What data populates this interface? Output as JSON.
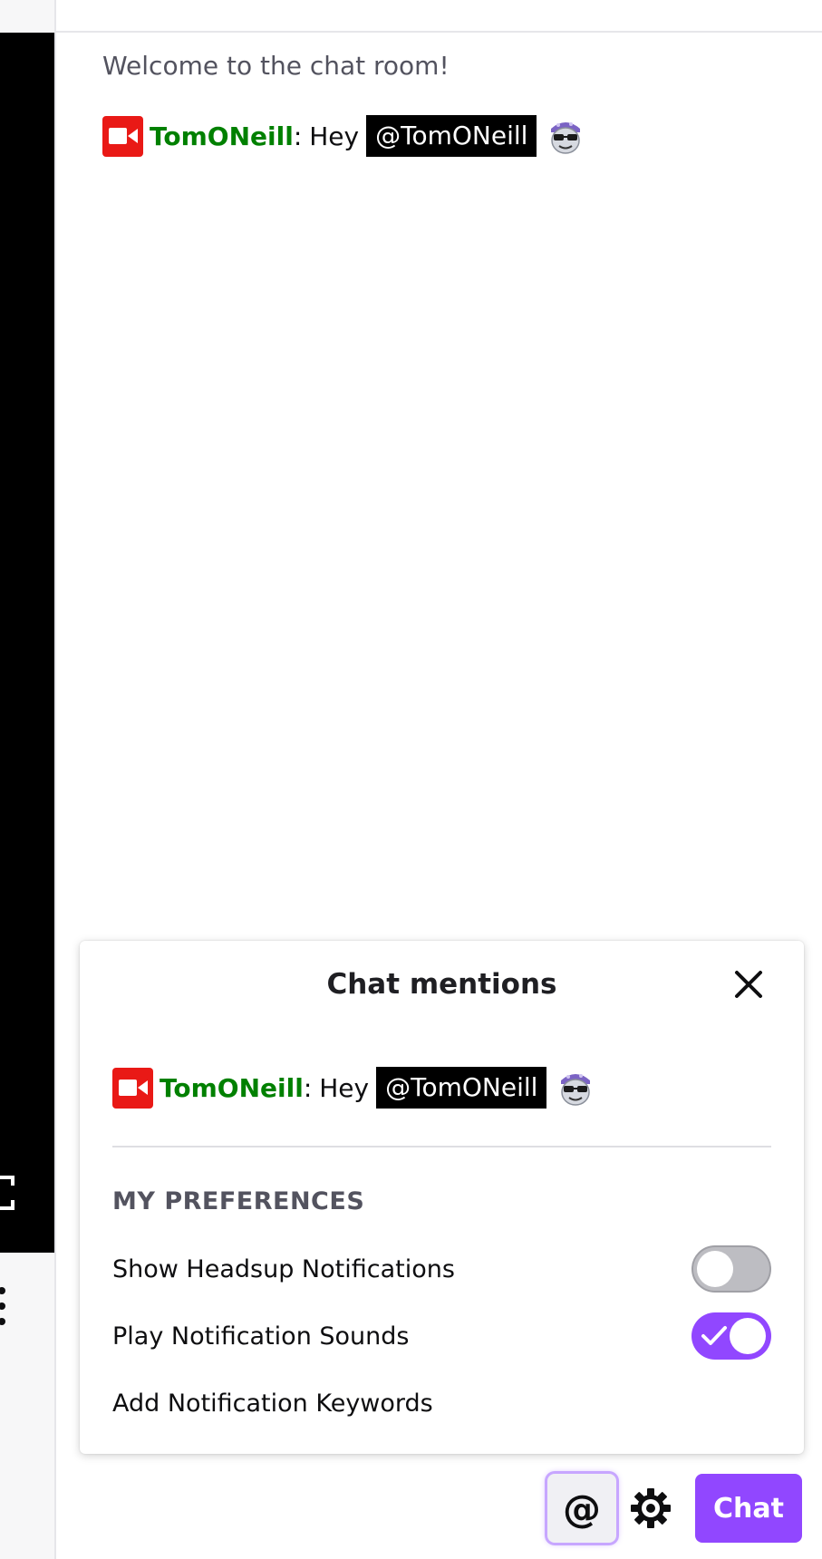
{
  "chat": {
    "welcome": "Welcome to the chat room!",
    "messages": [
      {
        "username": "TomONeill",
        "colon": ":",
        "text": "Hey",
        "mention": "@TomONeill",
        "badge_icon": "video-camera-icon",
        "emote_icon": "cool-face-emote-icon"
      }
    ]
  },
  "mentions_popup": {
    "title": "Chat mentions",
    "close_icon": "close-icon",
    "message": {
      "username": "TomONeill",
      "colon": ":",
      "text": "Hey",
      "mention": "@TomONeill"
    },
    "preferences_heading": "MY PREFERENCES",
    "preferences": [
      {
        "label": "Show Headsup Notifications",
        "enabled": false
      },
      {
        "label": "Play Notification Sounds",
        "enabled": true
      }
    ],
    "add_keywords_label": "Add Notification Keywords"
  },
  "bottom_bar": {
    "mention_label": "@",
    "gear_icon": "gear-icon",
    "chat_label": "Chat"
  },
  "colors": {
    "accent": "#9147ff",
    "username": "#008000",
    "badge": "#e91916",
    "mention_bg": "#000000"
  }
}
